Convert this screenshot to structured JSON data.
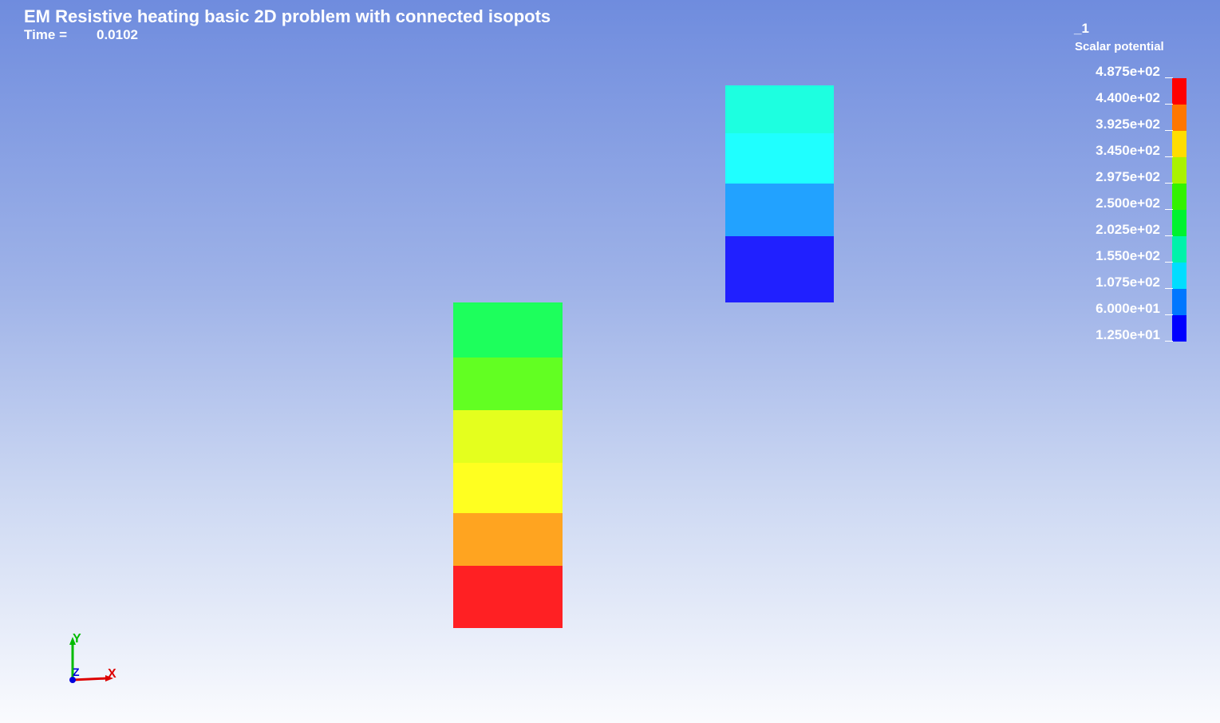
{
  "title": "EM Resistive heating basic 2D problem with connected isopots",
  "time": {
    "label": "Time =",
    "value": "0.0102"
  },
  "legend": {
    "index": "_1",
    "title": "Scalar potential",
    "labels": [
      "4.875e+02",
      "4.400e+02",
      "3.925e+02",
      "3.450e+02",
      "2.975e+02",
      "2.500e+02",
      "2.025e+02",
      "1.550e+02",
      "1.075e+02",
      "6.000e+01",
      "1.250e+01"
    ],
    "colors": [
      "#ff0000",
      "#ff7700",
      "#ffdd00",
      "#aaf200",
      "#33f200",
      "#00f230",
      "#00f2aa",
      "#00ddff",
      "#0077ff",
      "#0000ff"
    ]
  },
  "parts": {
    "left_column_colors": [
      "#1dff5c",
      "#62ff22",
      "#e4ff1e",
      "#ffff20",
      "#ffa420",
      "#ff2023"
    ],
    "right_column_colors": [
      "#1dffe0",
      "#1fffff",
      "#22a2ff",
      "#2020ff"
    ]
  },
  "triad": {
    "x_label": "X",
    "y_label": "Y",
    "z_label": "Z",
    "x_color": "#dd0000",
    "y_color": "#00bb00",
    "z_color": "#0000dd"
  }
}
